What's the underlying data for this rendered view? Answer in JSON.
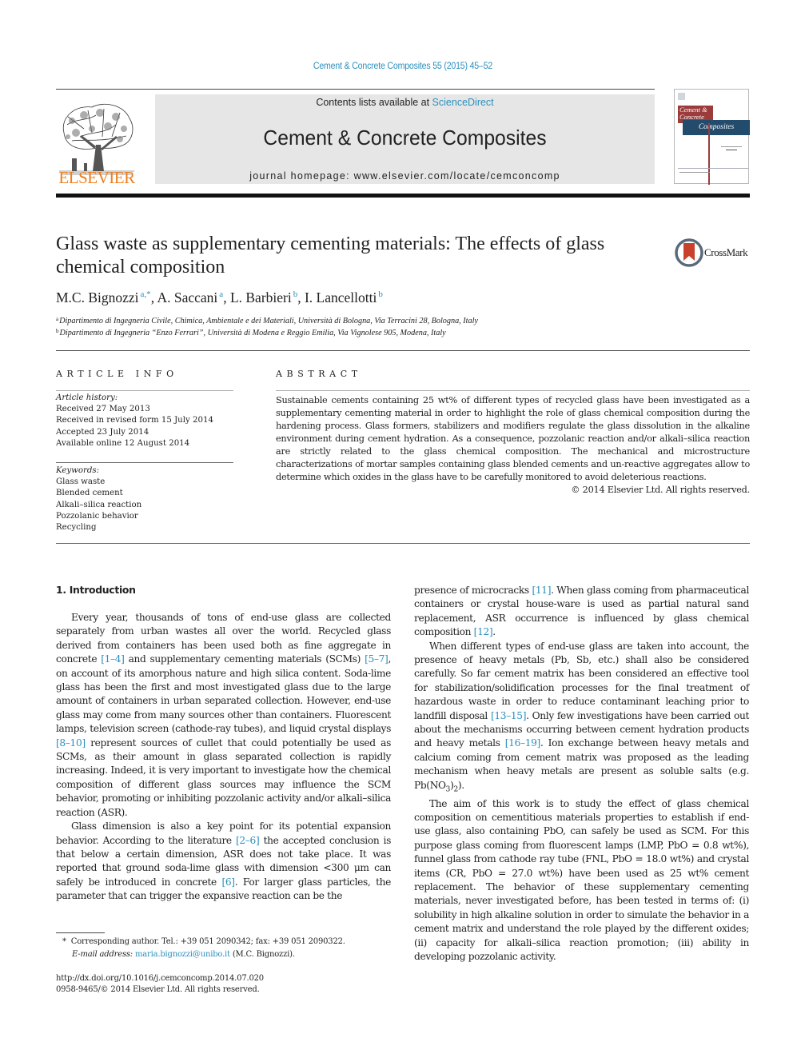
{
  "header": {
    "journal_ref": "Cement & Concrete Composites 55 (2015) 45–52",
    "contents_prefix": "Contents lists available at ",
    "contents_link": "ScienceDirect",
    "journal_title": "Cement & Concrete Composites",
    "homepage_prefix": "journal homepage: ",
    "homepage_url": "www.elsevier.com/locate/cemconcomp",
    "publisher_logo_text": "ELSEVIER",
    "cover": {
      "line1": "Cement &",
      "line2": "Concrete",
      "line3": "Composites"
    },
    "colors": {
      "link": "#2a8fbd",
      "elsevier_orange": "#f07f1d",
      "cover_red": "#9b3b3b",
      "cover_blue": "#234b6b"
    }
  },
  "article": {
    "title": "Glass waste as supplementary cementing materials: The effects of glass chemical composition",
    "crossmark_label": "CrossMark",
    "authors": [
      {
        "name": "M.C. Bignozzi",
        "sup": "a,*",
        "sep": ", "
      },
      {
        "name": "A. Saccani",
        "sup": "a",
        "sep": ", "
      },
      {
        "name": "L. Barbieri",
        "sup": "b",
        "sep": ", "
      },
      {
        "name": "I. Lancellotti",
        "sup": "b",
        "sep": ""
      }
    ],
    "affiliations": [
      {
        "mark": "a",
        "text": "Dipartimento di Ingegneria Civile, Chimica, Ambientale e dei Materiali, Università di Bologna, Via Terracini 28, Bologna, Italy"
      },
      {
        "mark": "b",
        "text": "Dipartimento di Ingegneria “Enzo Ferrari”, Università di Modena e Reggio Emilia, Via Vignolese 905, Modena, Italy"
      }
    ]
  },
  "article_info": {
    "heading": "ARTICLE INFO",
    "history_label": "Article history:",
    "history": [
      "Received 27 May 2013",
      "Received in revised form 15 July 2014",
      "Accepted 23 July 2014",
      "Available online 12 August 2014"
    ],
    "keywords_label": "Keywords:",
    "keywords": [
      "Glass waste",
      "Blended cement",
      "Alkali–silica reaction",
      "Pozzolanic behavior",
      "Recycling"
    ]
  },
  "abstract": {
    "heading": "ABSTRACT",
    "text": "Sustainable cements containing 25 wt% of different types of recycled glass have been investigated as a supplementary cementing material in order to highlight the role of glass chemical composition during the hardening process. Glass formers, stabilizers and modifiers regulate the glass dissolution in the alkaline environment during cement hydration. As a consequence, pozzolanic reaction and/or alkali–silica reaction are strictly related to the glass chemical composition. The mechanical and microstructure characterizations of mortar samples containing glass blended cements and un-reactive aggregates allow to determine which oxides in the glass have to be carefully monitored to avoid deleterious reactions.",
    "copyright": "© 2014 Elsevier Ltd. All rights reserved."
  },
  "body": {
    "section_heading": "1. Introduction",
    "left_paragraphs": [
      [
        {
          "t": "Every year, thousands of tons of end-use glass are collected separately from urban wastes all over the world. Recycled glass derived from containers has been used both as fine aggregate in concrete "
        },
        {
          "t": "[1–4]",
          "ref": true
        },
        {
          "t": " and supplementary cementing materials (SCMs) "
        },
        {
          "t": "[5–7]",
          "ref": true
        },
        {
          "t": ", on account of its amorphous nature and high silica content. Soda-lime glass has been the first and most investigated glass due to the large amount of containers in urban separated collection. However, end-use glass may come from many sources other than containers. Fluorescent lamps, television screen (cathode-ray tubes), and liquid crystal displays "
        },
        {
          "t": "[8–10]",
          "ref": true
        },
        {
          "t": " represent sources of cullet that could potentially be used as SCMs, as their amount in glass separated collection is rapidly increasing. Indeed, it is very important to investigate how the chemical composition of different glass sources may influence the SCM behavior, promoting or inhibiting pozzolanic activity and/or alkali–silica reaction (ASR)."
        }
      ],
      [
        {
          "t": "Glass dimension is also a key point for its potential expansion behavior. According to the literature "
        },
        {
          "t": "[2–6]",
          "ref": true
        },
        {
          "t": " the accepted conclusion is that below a certain dimension, ASR does not take place. It was reported that ground soda-lime glass with dimension <300 μm can safely be introduced in concrete "
        },
        {
          "t": "[6]",
          "ref": true
        },
        {
          "t": ". For larger glass particles, the parameter that can trigger the expansive reaction can be the"
        }
      ]
    ],
    "right_paragraphs": [
      [
        {
          "t": "presence of microcracks "
        },
        {
          "t": "[11]",
          "ref": true
        },
        {
          "t": ". When glass coming from pharmaceutical containers or crystal house-ware is used as partial natural sand replacement, ASR occurrence is influenced by glass chemical composition "
        },
        {
          "t": "[12]",
          "ref": true
        },
        {
          "t": "."
        }
      ],
      [
        {
          "t": "When different types of end-use glass are taken into account, the presence of heavy metals (Pb, Sb, etc.) shall also be considered carefully. So far cement matrix has been considered an effective tool for stabilization/solidification processes for the final treatment of hazardous waste in order to reduce contaminant leaching prior to landfill disposal "
        },
        {
          "t": "[13–15]",
          "ref": true
        },
        {
          "t": ". Only few investigations have been carried out about the mechanisms occurring between cement hydration products and heavy metals "
        },
        {
          "t": "[16–19]",
          "ref": true
        },
        {
          "t": ". Ion exchange between heavy metals and calcium coming from cement matrix was proposed as the leading mechanism when heavy metals are present as soluble salts (e.g. Pb(NO"
        },
        {
          "t": "3",
          "sub": true
        },
        {
          "t": ")"
        },
        {
          "t": "2",
          "sub": true
        },
        {
          "t": ")."
        }
      ],
      [
        {
          "t": "The aim of this work is to study the effect of glass chemical composition on cementitious materials properties to establish if end-use glass, also containing PbO, can safely be used as SCM. For this purpose glass coming from fluorescent lamps (LMP, PbO = 0.8 wt%), funnel glass from cathode ray tube (FNL, PbO = 18.0 wt%) and crystal items (CR, PbO = 27.0 wt%) have been used as 25 wt% cement replacement. The behavior of these supplementary cementing materials, never investigated before, has been tested in terms of: (i) solubility in high alkaline solution in order to simulate the behavior in a cement matrix and understand the role played by the different oxides; (ii) capacity for alkali–silica reaction promotion; (iii) ability in developing pozzolanic activity."
        }
      ]
    ]
  },
  "footnotes": {
    "corresponding_mark": "*",
    "corresponding_text": "Corresponding author. Tel.: +39 051 2090342; fax: +39 051 2090322.",
    "email_label": "E-mail address:",
    "email": "maria.bignozzi@unibo.it",
    "email_suffix": " (M.C. Bignozzi).",
    "doi": "http://dx.doi.org/10.1016/j.cemconcomp.2014.07.020",
    "issn": "0958-9465/© 2014 Elsevier Ltd. All rights reserved."
  }
}
